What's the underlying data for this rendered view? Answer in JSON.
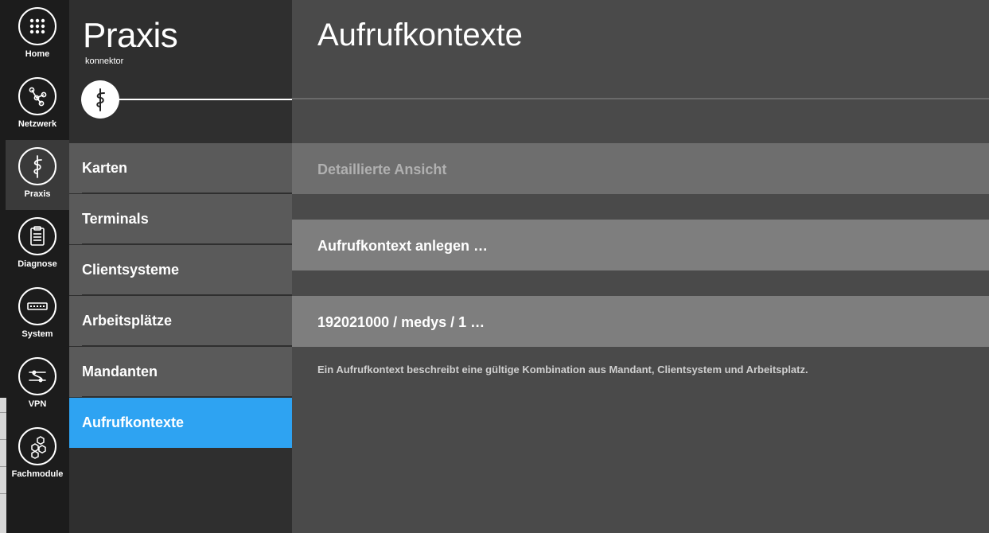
{
  "rail": {
    "items": [
      {
        "label": "Home",
        "icon": "grid-icon"
      },
      {
        "label": "Netzwerk",
        "icon": "network-icon"
      },
      {
        "label": "Praxis",
        "icon": "caduceus-icon",
        "active": true
      },
      {
        "label": "Diagnose",
        "icon": "clipboard-icon"
      },
      {
        "label": "System",
        "icon": "device-icon"
      },
      {
        "label": "VPN",
        "icon": "vpn-icon"
      },
      {
        "label": "Fachmodule",
        "icon": "hexagons-icon"
      }
    ]
  },
  "section": {
    "title": "Praxis",
    "subtitle": "konnektor",
    "badge_icon": "caduceus-icon"
  },
  "nav": {
    "items": [
      {
        "label": "Karten"
      },
      {
        "label": "Terminals"
      },
      {
        "label": "Clientsysteme"
      },
      {
        "label": "Arbeitsplätze"
      },
      {
        "label": "Mandanten"
      },
      {
        "label": "Aufrufkontexte",
        "active": true
      }
    ]
  },
  "main": {
    "title": "Aufrufkontexte",
    "detail_view_label": "Detaillierte Ansicht",
    "create_label": "Aufrufkontext anlegen …",
    "entries": [
      {
        "label": "192021000 / medys / 1 …"
      }
    ],
    "info_text": "Ein Aufrufkontext beschreibt eine gültige Kombination aus Mandant, Clientsystem und Arbeitsplatz."
  },
  "colors": {
    "accent": "#2ea3f2",
    "rail_bg": "#1c1c1c",
    "nav_bg": "#5a5a5a",
    "main_bg": "#4a4a4a"
  }
}
